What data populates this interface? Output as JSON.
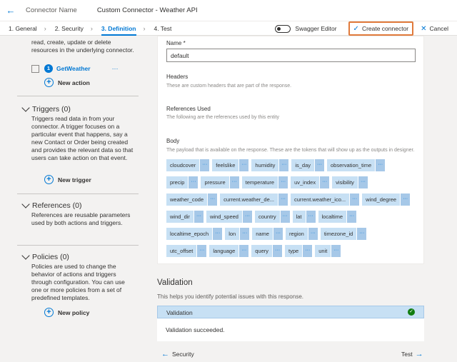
{
  "titlebar": {
    "connector_label": "Connector Name",
    "connector_name": "Custom Connector - Weather API"
  },
  "steps": [
    {
      "label": "1. General"
    },
    {
      "label": "2. Security"
    },
    {
      "label": "3. Definition"
    },
    {
      "label": "4. Test"
    }
  ],
  "tools": {
    "swagger_label": "Swagger Editor",
    "create_label": "Create connector",
    "cancel_label": "Cancel"
  },
  "left": {
    "actions_desc": "read, create, update or delete resources in the underlying connector.",
    "action_item": {
      "number": "1",
      "label": "GetWeather",
      "more": "···"
    },
    "new_action": "New action",
    "triggers": {
      "title": "Triggers (0)",
      "desc": "Triggers read data in from your connector. A trigger focuses on a particular event that happens, say a new Contact or Order being created and provides the relevant data so that users can take action on that event.",
      "add": "New trigger"
    },
    "references": {
      "title": "References (0)",
      "desc": "References are reusable parameters used by both actions and triggers."
    },
    "policies": {
      "title": "Policies (0)",
      "desc": "Policies are used to change the behavior of actions and triggers through configuration. You can use one or more policies from a set of predefined templates.",
      "add": "New policy"
    }
  },
  "response": {
    "name_label": "Name *",
    "name_value": "default",
    "headers_label": "Headers",
    "headers_desc": "These are custom headers that are part of the response.",
    "refs_label": "References Used",
    "refs_desc": "The following are the references used by this entity",
    "body_label": "Body",
    "body_desc": "The payload that is available on the response. These are the tokens that will show up as the outputs in designer.",
    "chip_more": "···",
    "chip_rows": [
      [
        "cloudcover",
        "feelslike",
        "humidity",
        "is_day",
        "observation_time"
      ],
      [
        "precip",
        "pressure",
        "temperature",
        "uv_index",
        "visibility"
      ],
      [
        "weather_code",
        "current.weather_de...",
        "current.weather_ico...",
        "wind_degree"
      ],
      [
        "wind_dir",
        "wind_speed",
        "country",
        "lat",
        "localtime"
      ],
      [
        "localtime_epoch",
        "lon",
        "name",
        "region",
        "timezone_id"
      ],
      [
        "utc_offset",
        "language",
        "query",
        "type",
        "unit"
      ]
    ]
  },
  "validation": {
    "title": "Validation",
    "subtitle": "This helps you identify potential issues with this response.",
    "header": "Validation",
    "status_icon": "✓",
    "message": "Validation succeeded."
  },
  "footer": {
    "prev": "Security",
    "next": "Test"
  }
}
